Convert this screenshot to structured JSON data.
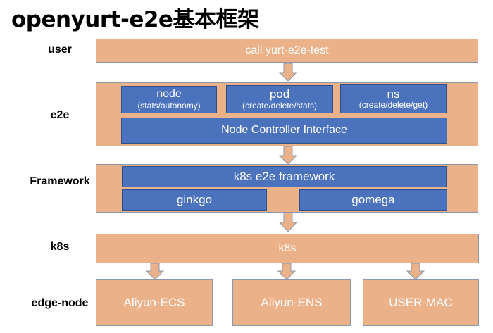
{
  "title": "openyurt-e2e基本框架",
  "colors": {
    "layer_fill": "#EBB28A",
    "component_fill": "#4A72BD",
    "text_light": "#FFFFFF"
  },
  "rows": {
    "user": {
      "label": "user",
      "box": "call yurt-e2e-test"
    },
    "e2e": {
      "label": "e2e",
      "components": [
        {
          "name": "node",
          "detail": "(stats/autonomy)"
        },
        {
          "name": "pod",
          "detail": "(create/delete/stats)"
        },
        {
          "name": "ns",
          "detail": "(create/delete/get)"
        }
      ],
      "interface": "Node Controller Interface"
    },
    "framework": {
      "label": "Framework",
      "main": "k8s e2e framework",
      "libs": [
        "ginkgo",
        "gomega"
      ]
    },
    "k8s": {
      "label": "k8s",
      "box": "k8s"
    },
    "edge_node": {
      "label": "edge-node",
      "nodes": [
        "Aliyun-ECS",
        "Aliyun-ENS",
        "USER-MAC"
      ]
    }
  }
}
